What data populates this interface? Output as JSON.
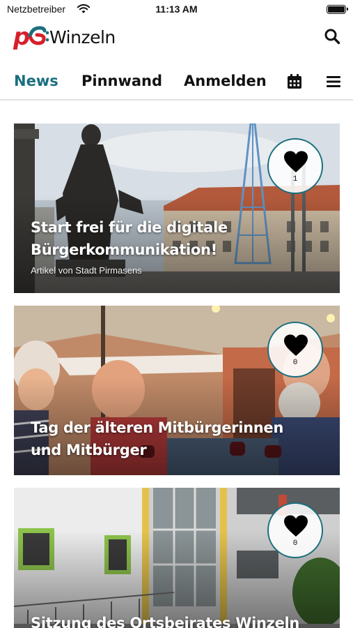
{
  "status_bar": {
    "carrier": "Netzbetreiber",
    "time": "11:13 AM"
  },
  "header": {
    "logo_name": "Winzeln",
    "brand_colors": {
      "red": "#d6202c",
      "teal": "#1a6f7e"
    }
  },
  "nav": {
    "items": [
      "News",
      "Pinnwand",
      "Anmelden"
    ],
    "active": "News",
    "icons": [
      "calendar-icon",
      "menu-icon"
    ]
  },
  "cards": [
    {
      "title": "Start frei für die digitale Bürgerkommunikation!",
      "subtitle": "Artikel von Stadt Pirmasens",
      "likes": "1"
    },
    {
      "title": "Tag der älteren Mitbürgerinnen und Mitbürger",
      "likes": "0"
    },
    {
      "title": "Sitzung des Ortsbeirates Winzeln",
      "likes": "0"
    }
  ]
}
